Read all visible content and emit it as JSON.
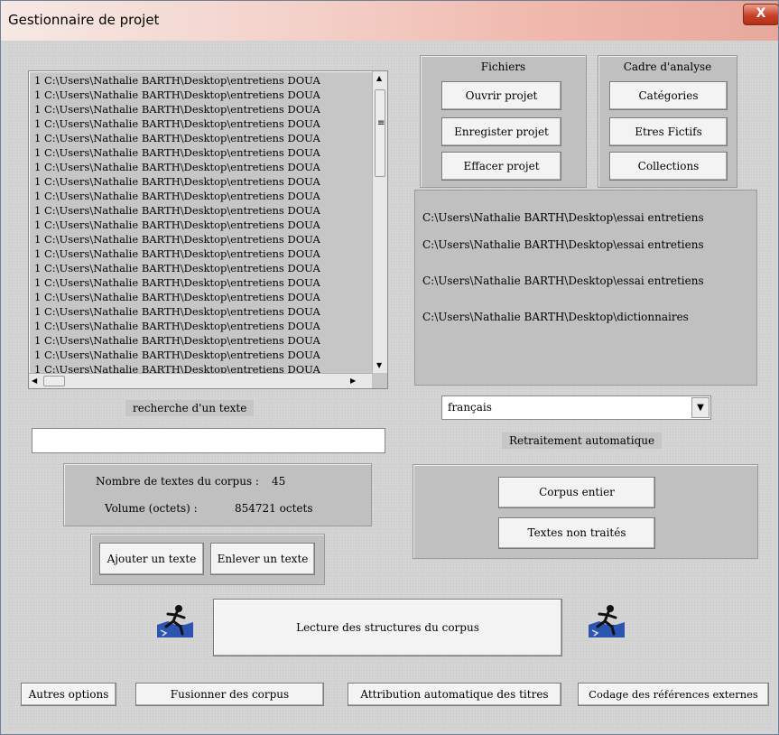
{
  "window": {
    "title": "Gestionnaire de projet",
    "close_glyph": "X"
  },
  "file_list": {
    "rows": [
      "1  C:\\Users\\Nathalie BARTH\\Desktop\\entretiens DOUA",
      "1  C:\\Users\\Nathalie BARTH\\Desktop\\entretiens DOUA",
      "1  C:\\Users\\Nathalie BARTH\\Desktop\\entretiens DOUA",
      "1  C:\\Users\\Nathalie BARTH\\Desktop\\entretiens DOUA",
      "1  C:\\Users\\Nathalie BARTH\\Desktop\\entretiens DOUA",
      "1  C:\\Users\\Nathalie BARTH\\Desktop\\entretiens DOUA",
      "1  C:\\Users\\Nathalie BARTH\\Desktop\\entretiens DOUA",
      "1  C:\\Users\\Nathalie BARTH\\Desktop\\entretiens DOUA",
      "1  C:\\Users\\Nathalie BARTH\\Desktop\\entretiens DOUA",
      "1  C:\\Users\\Nathalie BARTH\\Desktop\\entretiens DOUA",
      "1  C:\\Users\\Nathalie BARTH\\Desktop\\entretiens DOUA",
      "1  C:\\Users\\Nathalie BARTH\\Desktop\\entretiens DOUA",
      "1  C:\\Users\\Nathalie BARTH\\Desktop\\entretiens DOUA",
      "1  C:\\Users\\Nathalie BARTH\\Desktop\\entretiens DOUA",
      "1  C:\\Users\\Nathalie BARTH\\Desktop\\entretiens DOUA",
      "1  C:\\Users\\Nathalie BARTH\\Desktop\\entretiens DOUA",
      "1  C:\\Users\\Nathalie BARTH\\Desktop\\entretiens DOUA",
      "1  C:\\Users\\Nathalie BARTH\\Desktop\\entretiens DOUA",
      "1  C:\\Users\\Nathalie BARTH\\Desktop\\entretiens DOUA",
      "1  C:\\Users\\Nathalie BARTH\\Desktop\\entretiens DOUA",
      "1  C:\\Users\\Nathalie BARTH\\Desktop\\entretiens DOUA"
    ]
  },
  "fichiers": {
    "title": "Fichiers",
    "open": "Ouvrir projet",
    "save": "Enregister projet",
    "clear": "Effacer projet"
  },
  "cadre": {
    "title": "Cadre d'analyse",
    "categories": "Catégories",
    "etres": "Etres Fictifs",
    "collections": "Collections"
  },
  "paths": [
    "C:\\Users\\Nathalie BARTH\\Desktop\\essai entretiens",
    "C:\\Users\\Nathalie BARTH\\Desktop\\essai entretiens",
    "C:\\Users\\Nathalie BARTH\\Desktop\\essai entretiens",
    "C:\\Users\\Nathalie BARTH\\Desktop\\dictionnaires"
  ],
  "search": {
    "label": "recherche d'un texte",
    "value": ""
  },
  "language": {
    "selected": "français",
    "retraitement": "Retraitement automatique"
  },
  "stats": {
    "count_label": "Nombre de textes du corpus :",
    "count_value": "45",
    "volume_label": "Volume (octets) :",
    "volume_value": "854721 octets"
  },
  "text_buttons": {
    "add": "Ajouter un texte",
    "remove": "Enlever un texte"
  },
  "corpus_buttons": {
    "entire": "Corpus entier",
    "untreated": "Textes non traités"
  },
  "lecture": {
    "label": "Lecture des structures du corpus"
  },
  "bottom": {
    "autres": "Autres options",
    "fusionner": "Fusionner des corpus",
    "attribution": "Attribution automatique des titres",
    "codage": "Codage des références externes"
  },
  "icons": [
    "runner-icon",
    "chevron-down-icon",
    "close-icon"
  ]
}
